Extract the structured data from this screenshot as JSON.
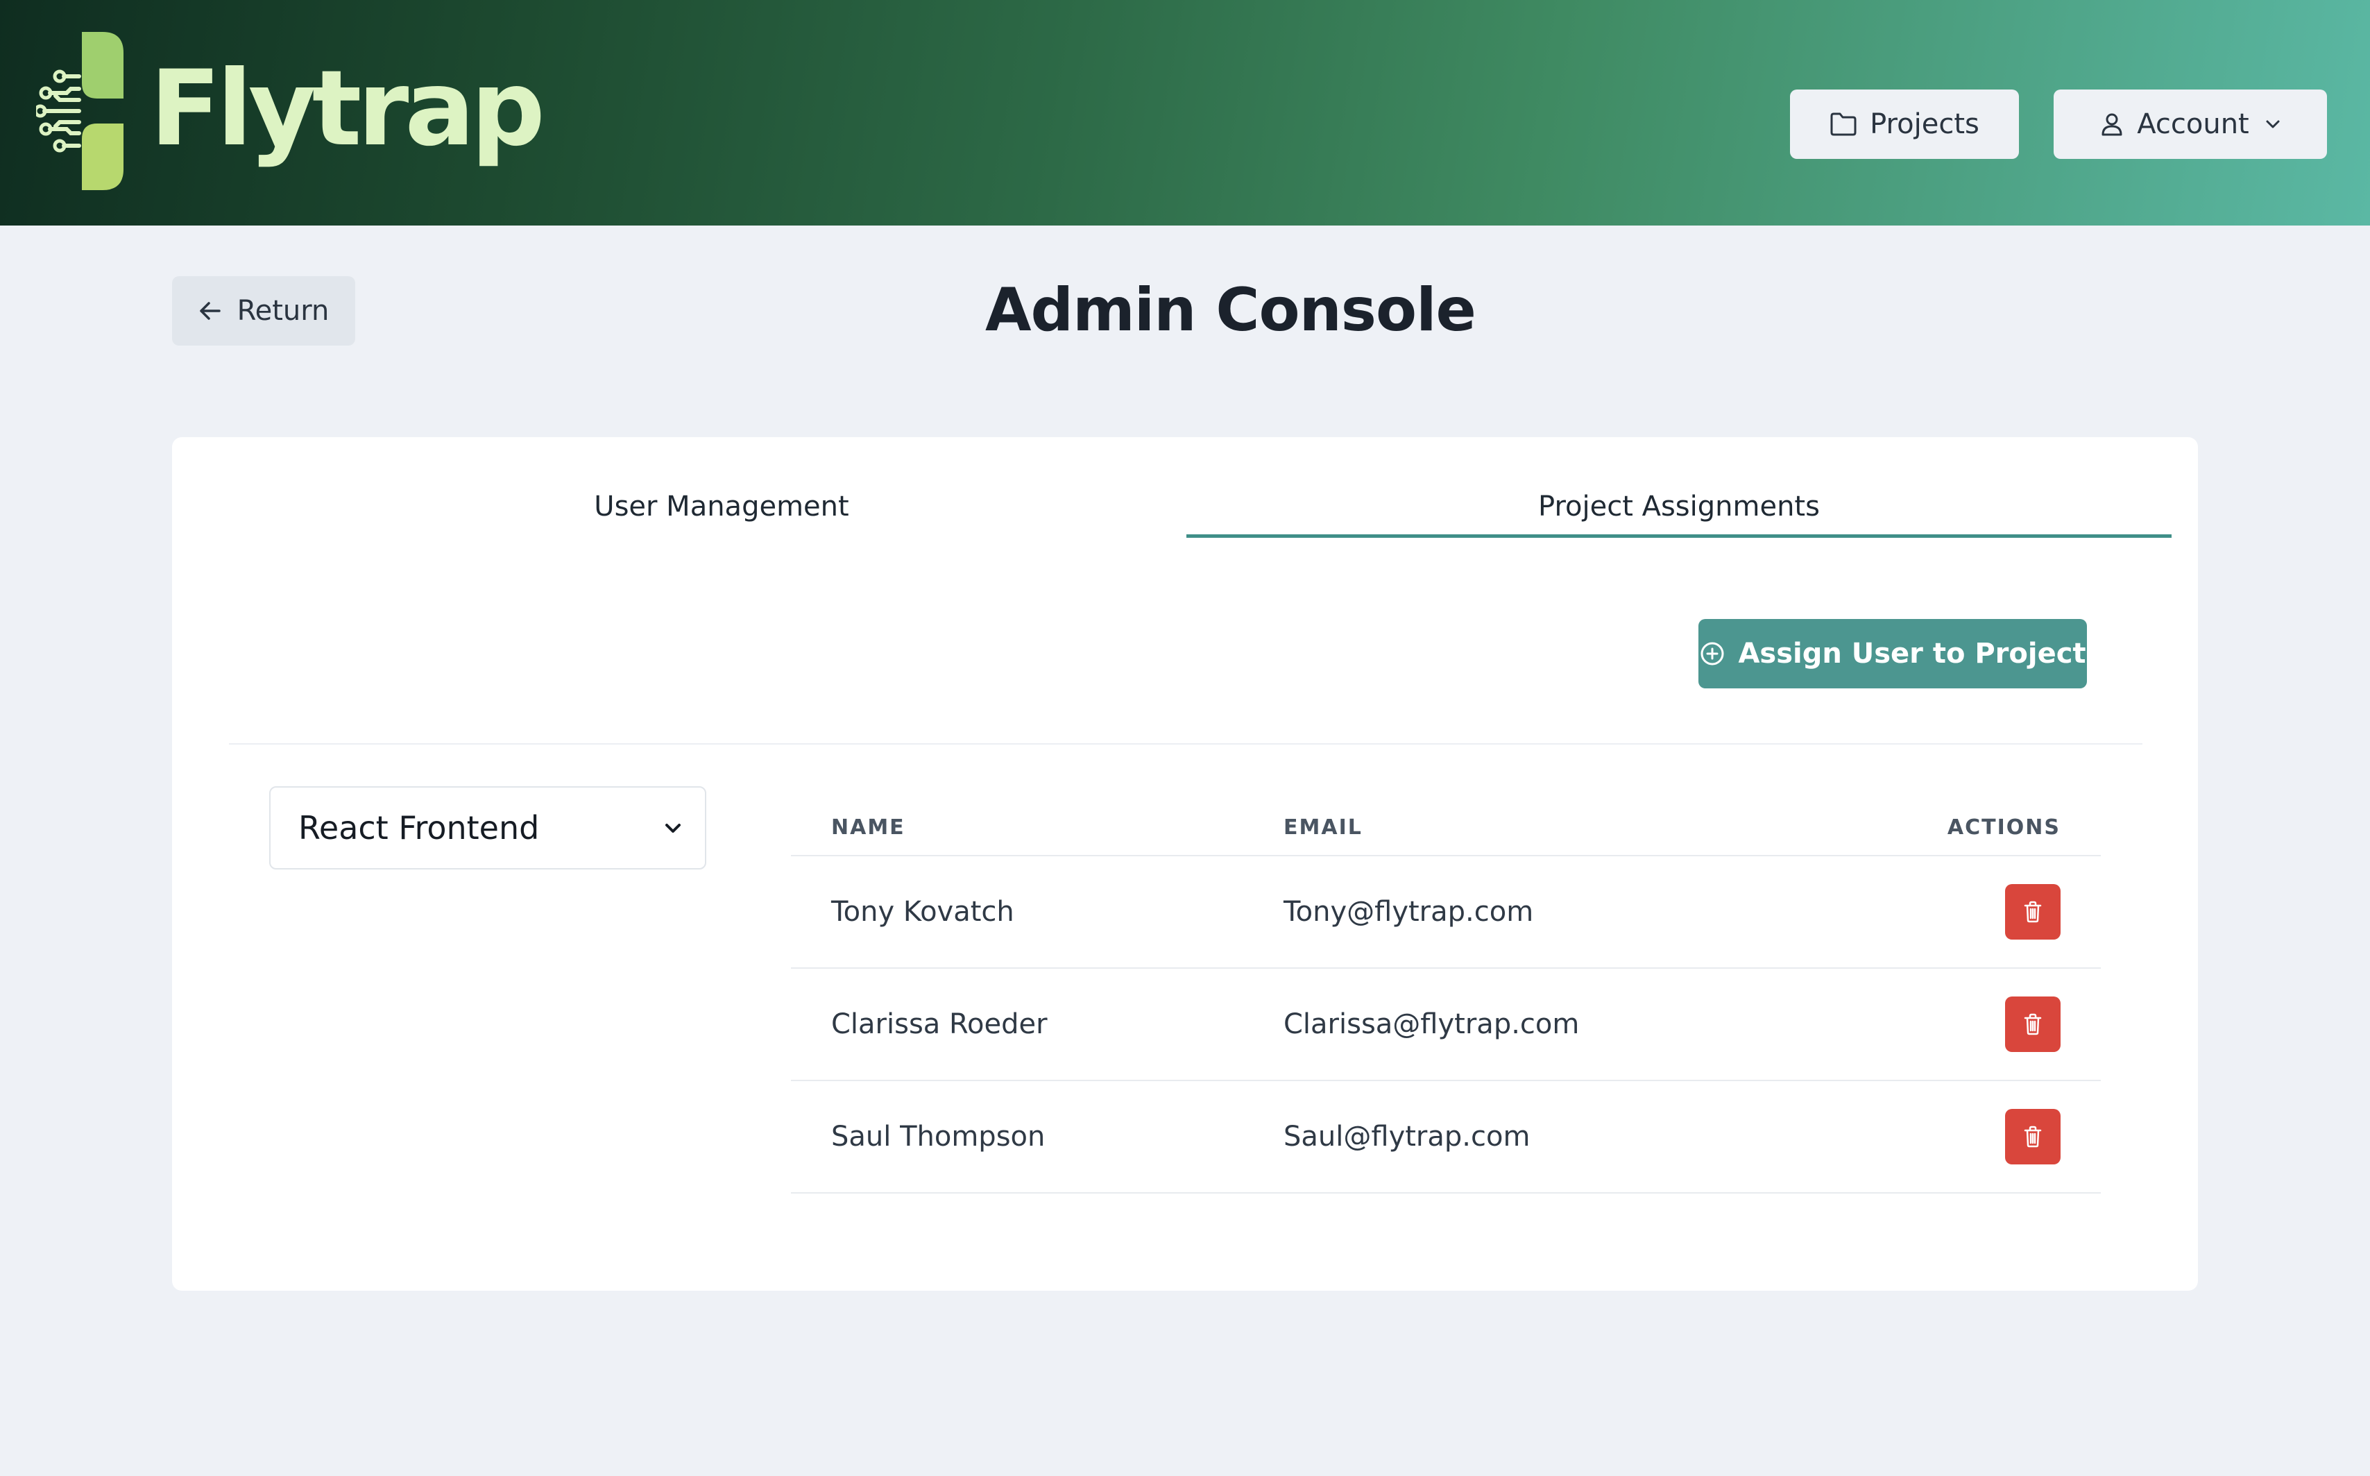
{
  "header": {
    "logo_text": "Flytrap",
    "projects_label": "Projects",
    "account_label": "Account"
  },
  "page": {
    "return_label": "Return",
    "title": "Admin Console"
  },
  "tabs": [
    {
      "label": "User Management",
      "active": false
    },
    {
      "label": "Project Assignments",
      "active": true
    }
  ],
  "actions": {
    "assign_label": "Assign User to Project"
  },
  "project_select": {
    "selected": "React Frontend"
  },
  "table": {
    "columns": [
      "NAME",
      "EMAIL",
      "ACTIONS"
    ],
    "rows": [
      {
        "name": "Tony Kovatch",
        "email": "Tony@flytrap.com"
      },
      {
        "name": "Clarissa Roeder",
        "email": "Clarissa@flytrap.com"
      },
      {
        "name": "Saul Thompson",
        "email": "Saul@flytrap.com"
      }
    ]
  },
  "colors": {
    "accent": "#4c9690",
    "danger": "#d9463c",
    "logo": "#ddf3c3",
    "header_dark": "#0f2d20",
    "header_light": "#5bb8a4"
  },
  "icons": {
    "logo": "flytrap-circuit-logo-icon",
    "projects": "folder-icon",
    "account": "user-icon",
    "account_chevron": "chevron-down-icon",
    "return": "arrow-left-icon",
    "assign": "plus-circle-icon",
    "select_chevron": "chevron-down-icon",
    "delete": "trash-icon"
  }
}
